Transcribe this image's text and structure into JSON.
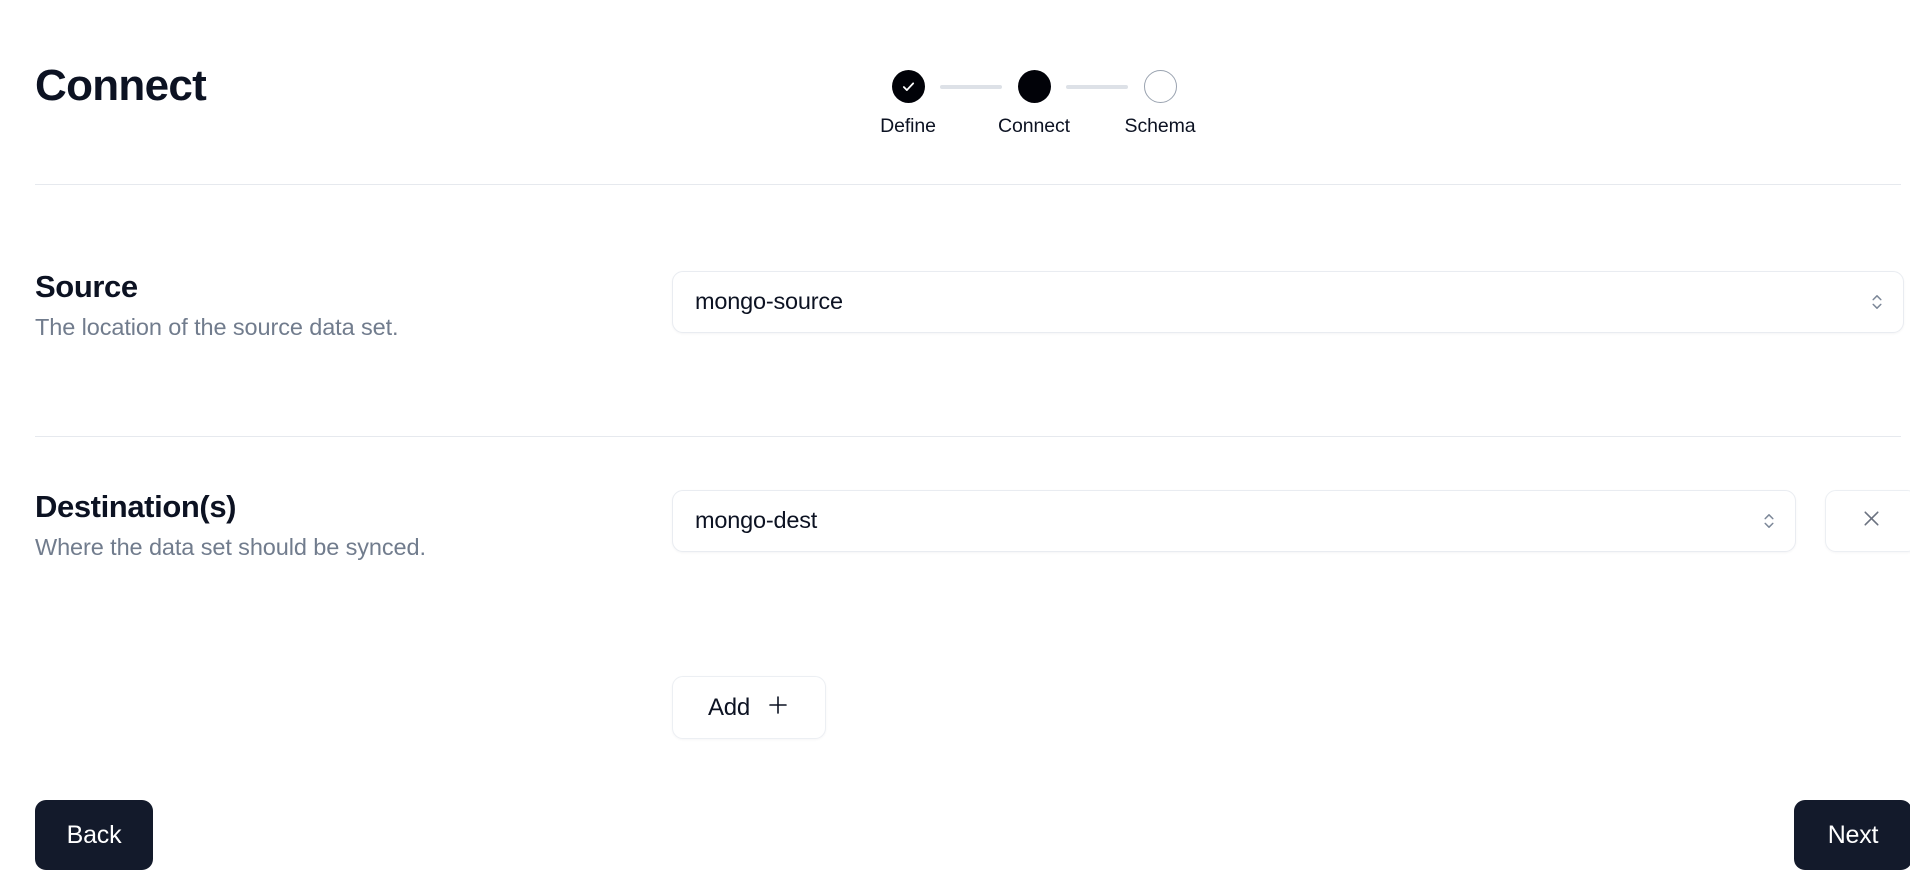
{
  "header": {
    "title": "Connect"
  },
  "stepper": {
    "steps": [
      {
        "label": "Define",
        "state": "done",
        "icon": "check-icon"
      },
      {
        "label": "Connect",
        "state": "active",
        "icon": "filled-dot-icon"
      },
      {
        "label": "Schema",
        "state": "todo",
        "icon": "empty-circle-icon"
      }
    ]
  },
  "sections": [
    {
      "title": "Source",
      "description": "The location of the source data set.",
      "select_value": "mongo-source",
      "select_icon": "chevron-up-down-icon"
    },
    {
      "title": "Destination(s)",
      "description": "Where the data set should be synced.",
      "select_value": "mongo-dest",
      "select_icon": "chevron-up-down-icon",
      "remove_icon": "close-icon"
    }
  ],
  "add_button": {
    "label": "Add",
    "icon": "plus-icon"
  },
  "footer": {
    "back_label": "Back",
    "next_label": "Next"
  },
  "colors": {
    "background": "#ffffff",
    "text_primary": "#0c1222",
    "text_muted": "#717c8d",
    "border": "#e9ecf1",
    "divider": "#e6e9ee",
    "step_active": "#010208",
    "step_pending_border": "#9aa3b0",
    "connector": "#dde1e7",
    "button_dark": "#131a2b",
    "button_dark_text": "#ffffff"
  }
}
